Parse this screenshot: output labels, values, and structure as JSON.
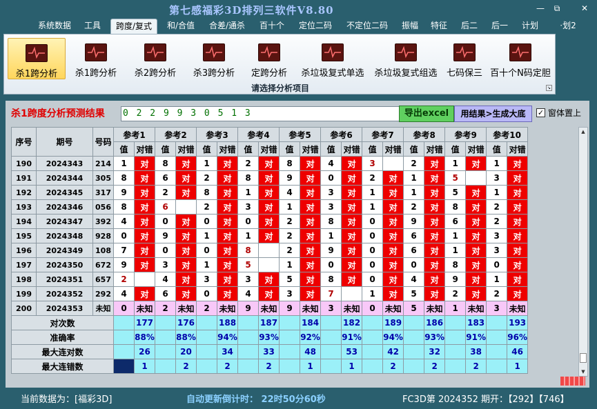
{
  "window": {
    "title": "第七感福彩3D排列三软件V8.80",
    "controls": [
      "—",
      "⧉",
      "✕"
    ]
  },
  "menu": [
    "系统数据",
    "工具",
    "跨度/复式",
    "和/合值",
    "合差/通杀",
    "百十个",
    "定位二码",
    "不定位二码",
    "振幅",
    "特征",
    "后二",
    "后一",
    "计划",
    "·划2"
  ],
  "ribbon": {
    "buttons": [
      "杀1跨分析",
      "杀1跨分析",
      "杀2跨分析",
      "杀3跨分析",
      "定跨分析",
      "杀垃圾复式单选",
      "杀垃圾复式组选",
      "七码保三",
      "百十个N码定胆"
    ],
    "group_label": "请选择分析项目"
  },
  "result": {
    "title": "杀1跨度分析预测结果",
    "digits": "0 2 2 9 9 3 0 5 1 3",
    "excel_label": "导出excel",
    "generate_label": "用结果>生成大底",
    "ontop_label": "窗体置上",
    "ontop_checked": "✓"
  },
  "table": {
    "headers": {
      "seq": "序号",
      "period": "期号",
      "number": "号码"
    },
    "refs": [
      "参考1",
      "参考2",
      "参考3",
      "参考4",
      "参考5",
      "参考6",
      "参考7",
      "参考8",
      "参考9",
      "参考10"
    ],
    "sub": [
      "值",
      "对错"
    ],
    "mark_text": "对",
    "rows": [
      {
        "seq": "190",
        "period": "2024343",
        "number": "214",
        "cells": [
          [
            "1",
            1
          ],
          [
            "8",
            1
          ],
          [
            "1",
            1
          ],
          [
            "2",
            1
          ],
          [
            "8",
            1
          ],
          [
            "4",
            1
          ],
          [
            "3",
            2
          ],
          [
            "2",
            1
          ],
          [
            "1",
            1
          ],
          [
            "1",
            1
          ]
        ]
      },
      {
        "seq": "191",
        "period": "2024344",
        "number": "305",
        "cells": [
          [
            "8",
            1
          ],
          [
            "6",
            1
          ],
          [
            "2",
            1
          ],
          [
            "8",
            1
          ],
          [
            "9",
            1
          ],
          [
            "0",
            1
          ],
          [
            "2",
            1
          ],
          [
            "1",
            1
          ],
          [
            "5",
            2
          ],
          [
            "3",
            1
          ]
        ]
      },
      {
        "seq": "192",
        "period": "2024345",
        "number": "317",
        "cells": [
          [
            "9",
            1
          ],
          [
            "2",
            1
          ],
          [
            "8",
            1
          ],
          [
            "1",
            1
          ],
          [
            "4",
            1
          ],
          [
            "3",
            1
          ],
          [
            "1",
            1
          ],
          [
            "1",
            1
          ],
          [
            "5",
            1
          ],
          [
            "1",
            1
          ]
        ]
      },
      {
        "seq": "193",
        "period": "2024346",
        "number": "056",
        "cells": [
          [
            "8",
            1
          ],
          [
            "6",
            2
          ],
          [
            "2",
            1
          ],
          [
            "3",
            1
          ],
          [
            "1",
            1
          ],
          [
            "3",
            1
          ],
          [
            "1",
            1
          ],
          [
            "2",
            1
          ],
          [
            "8",
            1
          ],
          [
            "2",
            1
          ]
        ]
      },
      {
        "seq": "194",
        "period": "2024347",
        "number": "392",
        "cells": [
          [
            "4",
            1
          ],
          [
            "0",
            1
          ],
          [
            "0",
            1
          ],
          [
            "0",
            1
          ],
          [
            "2",
            1
          ],
          [
            "8",
            1
          ],
          [
            "0",
            1
          ],
          [
            "9",
            1
          ],
          [
            "6",
            1
          ],
          [
            "2",
            1
          ]
        ]
      },
      {
        "seq": "195",
        "period": "2024348",
        "number": "928",
        "cells": [
          [
            "0",
            1
          ],
          [
            "9",
            1
          ],
          [
            "1",
            1
          ],
          [
            "1",
            1
          ],
          [
            "2",
            1
          ],
          [
            "1",
            1
          ],
          [
            "0",
            1
          ],
          [
            "6",
            1
          ],
          [
            "1",
            1
          ],
          [
            "3",
            1
          ]
        ]
      },
      {
        "seq": "196",
        "period": "2024349",
        "number": "108",
        "cells": [
          [
            "7",
            1
          ],
          [
            "0",
            1
          ],
          [
            "0",
            1
          ],
          [
            "8",
            2
          ],
          [
            "2",
            1
          ],
          [
            "9",
            1
          ],
          [
            "0",
            1
          ],
          [
            "6",
            1
          ],
          [
            "1",
            1
          ],
          [
            "3",
            1
          ]
        ]
      },
      {
        "seq": "197",
        "period": "2024350",
        "number": "672",
        "cells": [
          [
            "9",
            1
          ],
          [
            "3",
            1
          ],
          [
            "1",
            1
          ],
          [
            "5",
            2
          ],
          [
            "1",
            1
          ],
          [
            "0",
            1
          ],
          [
            "0",
            1
          ],
          [
            "0",
            1
          ],
          [
            "8",
            1
          ],
          [
            "0",
            1
          ]
        ]
      },
      {
        "seq": "198",
        "period": "2024351",
        "number": "657",
        "cells": [
          [
            "2",
            2
          ],
          [
            "4",
            1
          ],
          [
            "3",
            1
          ],
          [
            "3",
            1
          ],
          [
            "5",
            1
          ],
          [
            "8",
            1
          ],
          [
            "0",
            1
          ],
          [
            "4",
            1
          ],
          [
            "9",
            1
          ],
          [
            "1",
            1
          ]
        ]
      },
      {
        "seq": "199",
        "period": "2024352",
        "number": "292",
        "cells": [
          [
            "4",
            1
          ],
          [
            "6",
            1
          ],
          [
            "0",
            1
          ],
          [
            "4",
            1
          ],
          [
            "3",
            1
          ],
          [
            "7",
            2
          ],
          [
            "1",
            1
          ],
          [
            "5",
            1
          ],
          [
            "2",
            1
          ],
          [
            "2",
            1
          ]
        ]
      }
    ],
    "pending": {
      "seq": "200",
      "period": "2024353",
      "number": "未知",
      "values": [
        "0",
        "2",
        "2",
        "9",
        "9",
        "3",
        "0",
        "5",
        "1",
        "3"
      ],
      "mark": "未知"
    },
    "stats": [
      {
        "label": "对次数",
        "values": [
          "177",
          "176",
          "188",
          "187",
          "184",
          "182",
          "189",
          "186",
          "183",
          "193"
        ]
      },
      {
        "label": "准确率",
        "values": [
          "88%",
          "88%",
          "94%",
          "93%",
          "92%",
          "91%",
          "94%",
          "93%",
          "91%",
          "96%"
        ]
      },
      {
        "label": "最大连对数",
        "values": [
          "26",
          "20",
          "34",
          "33",
          "48",
          "53",
          "42",
          "32",
          "38",
          "46"
        ]
      },
      {
        "label": "最大连错数",
        "values": [
          "1",
          "2",
          "2",
          "2",
          "1",
          "1",
          "2",
          "2",
          "2",
          "1"
        ]
      }
    ]
  },
  "status": {
    "data_source": "当前数据为：[福彩3D]",
    "countdown": "自动更新倒计时：  22时50分60秒",
    "issue": "FC3D第  2024352  期开：【292】【746】"
  }
}
